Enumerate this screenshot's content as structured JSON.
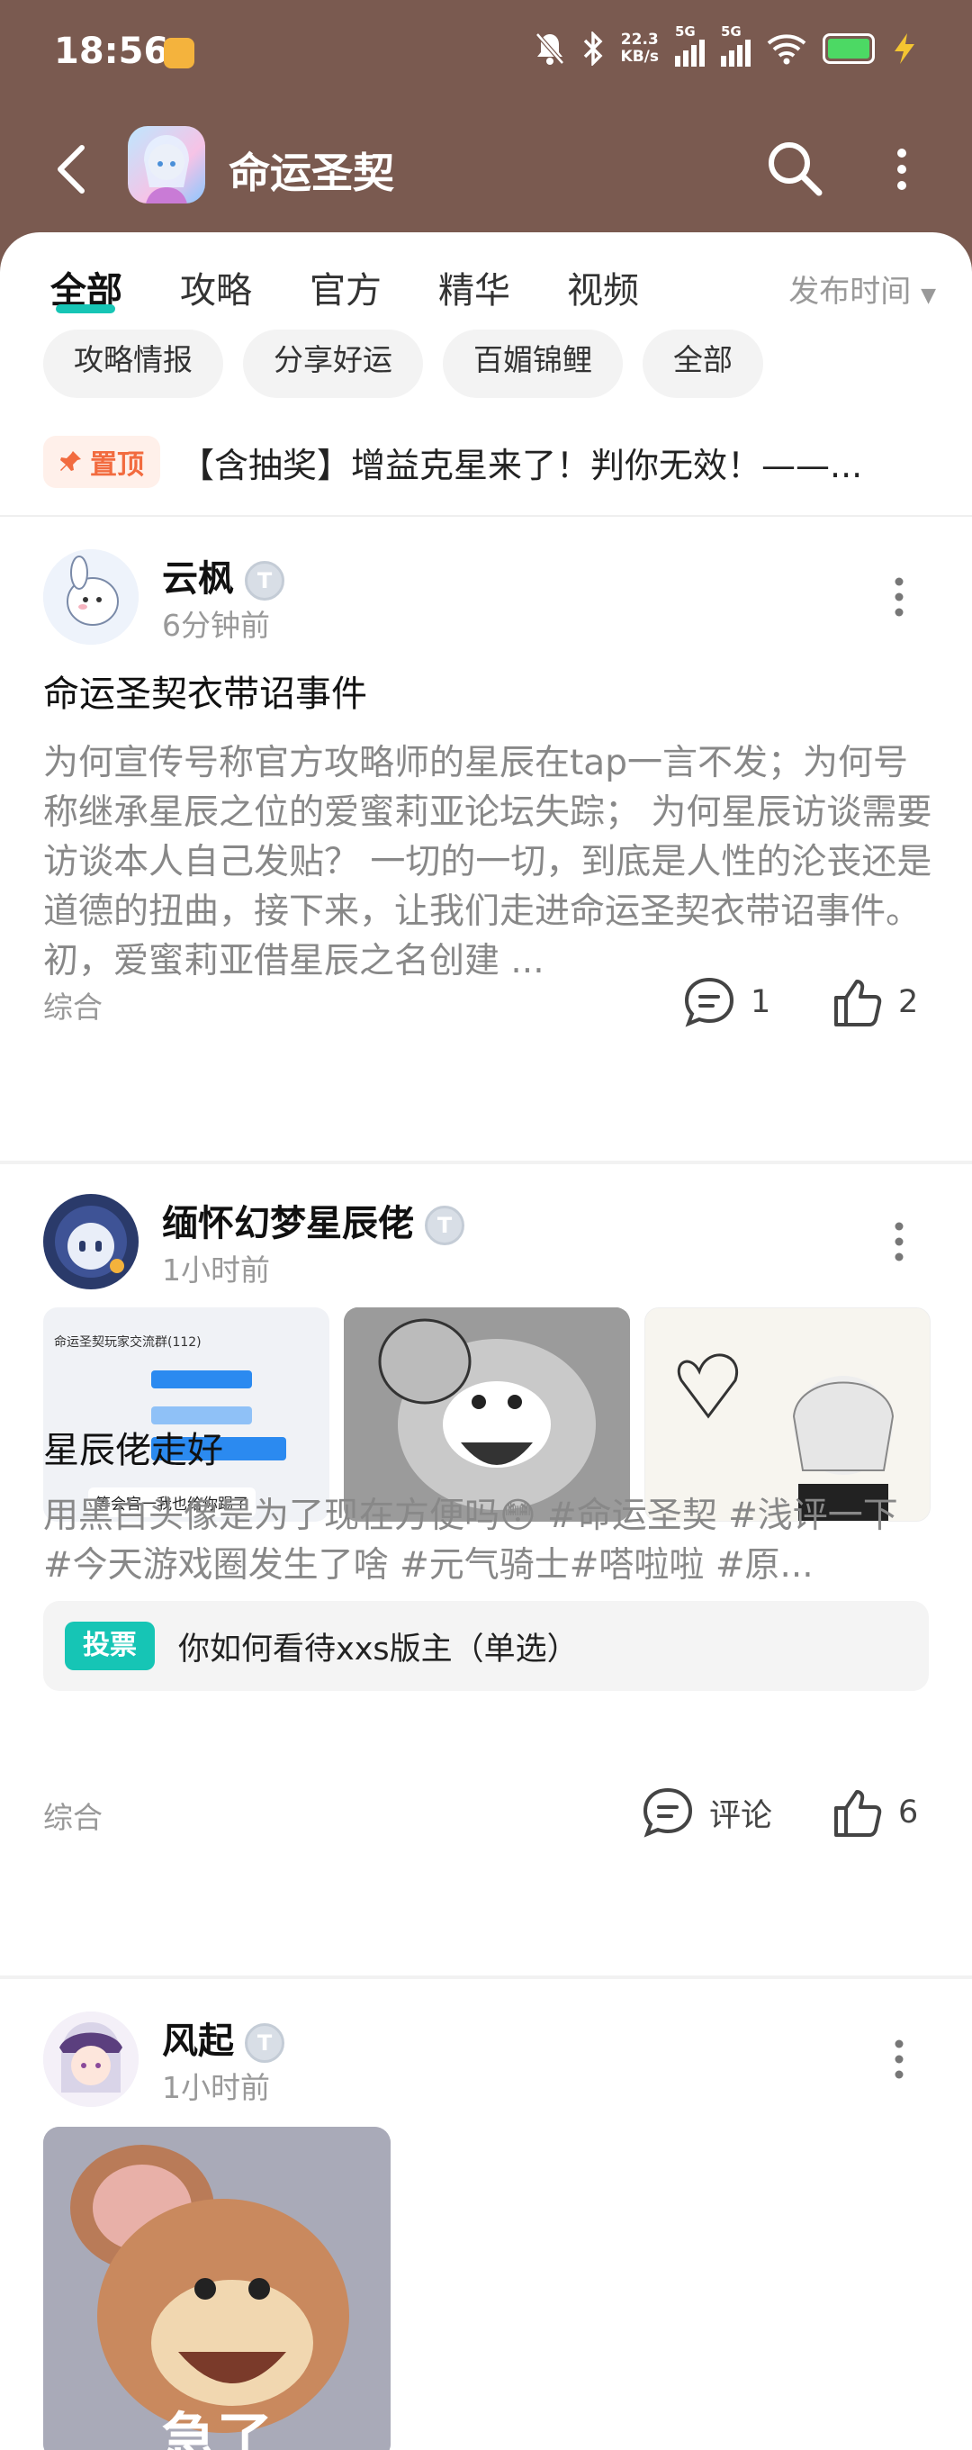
{
  "status": {
    "time": "18:56",
    "net_speed_value": "22.3",
    "net_speed_unit": "KB/s",
    "sim1": "5G",
    "sim2": "5G"
  },
  "header": {
    "title": "命运圣契"
  },
  "tabs": [
    {
      "label": "全部"
    },
    {
      "label": "攻略"
    },
    {
      "label": "官方"
    },
    {
      "label": "精华"
    },
    {
      "label": "视频"
    }
  ],
  "sort_label": "发布时间",
  "chips": [
    {
      "label": "攻略情报"
    },
    {
      "label": "分享好运"
    },
    {
      "label": "百媚锦鲤"
    },
    {
      "label": "全部"
    }
  ],
  "pinned": {
    "badge": "置顶",
    "text": "【含抽奖】增益克星来了！判你无效！——..."
  },
  "posts": [
    {
      "username": "云枫",
      "level": "T",
      "time": "6分钟前",
      "title": "命运圣契衣带诏事件",
      "body": "为何宣传号称官方攻略师的星辰在tap一言不发；为何号称继承星辰之位的爱蜜莉亚论坛失踪； 为何星辰访谈需要访谈本人自己发贴？ 一切的一切，到底是人性的沦丧还是道德的扭曲，接下来，让我们走进命运圣契衣带诏事件。 初，爱蜜莉亚借星辰之名创建 ...",
      "category": "综合",
      "comments": "1",
      "likes": "2"
    },
    {
      "username": "缅怀幻梦星辰佬",
      "level": "T",
      "time": "1小时前",
      "thumb1_header": "命运圣契玩家交流群(112)",
      "thumb1_caption": "等会官一我也给你踢了",
      "title": "星辰佬走好",
      "body": "用黑白头像是为了现在方便吗😳 #命运圣契 #浅评一下 #今天游戏圈发生了啥 #元气骑士#嗒啦啦 #原...",
      "vote_badge": "投票",
      "vote_text": "你如何看待xxs版主（单选）",
      "category": "综合",
      "comments": "评论",
      "likes": "6"
    },
    {
      "username": "风起",
      "level": "T",
      "time": "1小时前",
      "image_caption": "急了"
    }
  ],
  "colors": {
    "header_bg": "#7a5a50",
    "accent": "#16c5b5",
    "pin": "#f26b3f"
  }
}
